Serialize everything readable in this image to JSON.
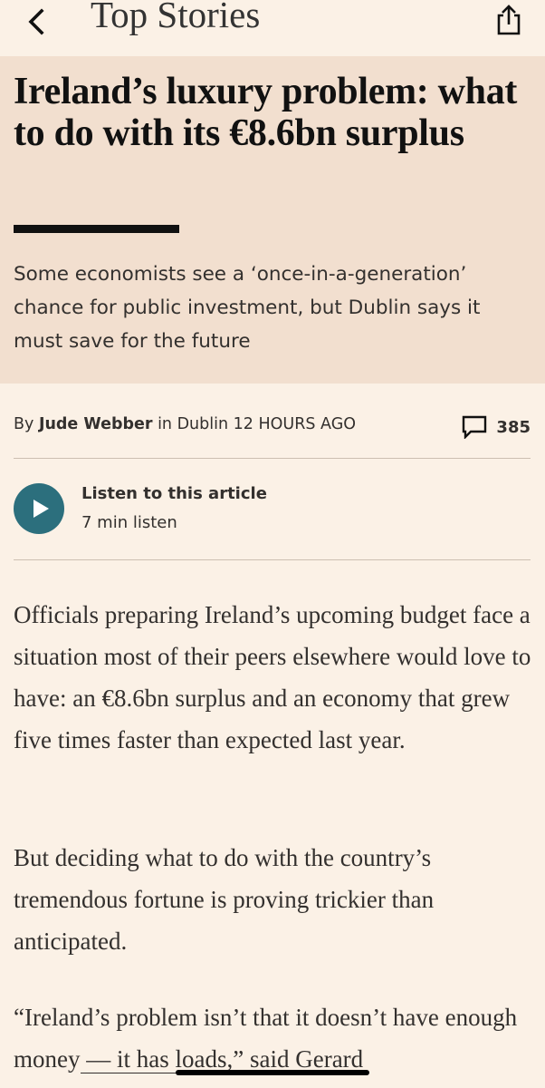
{
  "nav": {
    "back_icon": "chevron-left-icon",
    "title": "Top Stories",
    "share_icon": "share-icon"
  },
  "article": {
    "headline": "Ireland’s luxury problem: what to do with its €8.6bn surplus",
    "standfirst": "Some economists see a ‘once-in-a-generation’ chance for public investment, but Dublin says it must save for the future",
    "byline": {
      "prefix": "By ",
      "author": "Jude Webber",
      "location": " in Dublin ",
      "time": "12 HOURS AGO"
    },
    "comments": {
      "icon": "comment-icon",
      "count": "385"
    },
    "listen": {
      "icon": "play-icon",
      "title": "Listen to this article",
      "duration": "7 min listen"
    },
    "paragraphs": [
      "Officials preparing Ireland’s upcoming budget face a situation most of their peers elsewhere would love to have: an €8.6bn surplus and an economy that grew five times faster than expected last year.",
      "But deciding what to do with the country’s tremendous fortune is proving trickier than anticipated."
    ],
    "quote": {
      "before": "“Ireland’s problem isn’t that it doesn’t have enough money",
      "link": " — it has loads,”",
      "after": " said Gerard"
    }
  },
  "colors": {
    "background": "#fbf1e6",
    "hero_background": "#f2dfcf",
    "accent_teal": "#2c6f7d",
    "headline": "#111111",
    "text": "#33302e"
  }
}
